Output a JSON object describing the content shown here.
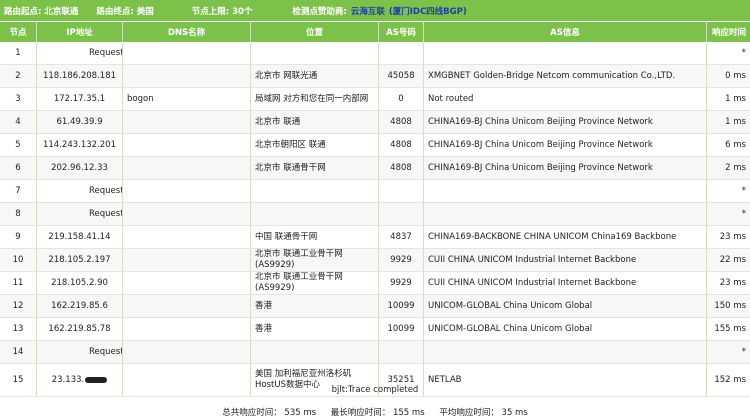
{
  "topbar": {
    "start": "路由起点: 北京联通",
    "end": "路由终点: 美国",
    "limit": "节点上限: 30个",
    "sponsor_label": "检测点赞助商:",
    "sponsor_name": "云海互联",
    "sponsor_detail": "(厦门IDC四线BGP)"
  },
  "columns": [
    "节点",
    "IP地址",
    "DNS名称",
    "位置",
    "AS号码",
    "AS信息",
    "响应时间"
  ],
  "rows": [
    {
      "hop": "1",
      "ip": "Request TimeOut",
      "dns": "",
      "loc": "",
      "as": "",
      "asinfo": "",
      "time": "*",
      "timeout": true
    },
    {
      "hop": "2",
      "ip": "118.186.208.181",
      "dns": "",
      "loc": "北京市 网联光通",
      "as": "45058",
      "asinfo": "XMGBNET Golden-Bridge Netcom communication Co.,LTD.",
      "time": "0 ms"
    },
    {
      "hop": "3",
      "ip": "172.17.35.1",
      "dns": "bogon",
      "loc": "局域网 对方和您在同一内部网",
      "as": "0",
      "asinfo": "Not routed",
      "time": "1 ms"
    },
    {
      "hop": "4",
      "ip": "61.49.39.9",
      "dns": "",
      "loc": "北京市 联通",
      "as": "4808",
      "asinfo": "CHINA169-BJ China Unicom Beijing Province Network",
      "time": "1 ms"
    },
    {
      "hop": "5",
      "ip": "114.243.132.201",
      "dns": "",
      "loc": "北京市朝阳区 联通",
      "as": "4808",
      "asinfo": "CHINA169-BJ China Unicom Beijing Province Network",
      "time": "6 ms"
    },
    {
      "hop": "6",
      "ip": "202.96.12.33",
      "dns": "",
      "loc": "北京市 联通骨干网",
      "as": "4808",
      "asinfo": "CHINA169-BJ China Unicom Beijing Province Network",
      "time": "2 ms"
    },
    {
      "hop": "7",
      "ip": "Request TimeOut",
      "dns": "",
      "loc": "",
      "as": "",
      "asinfo": "",
      "time": "*",
      "timeout": true
    },
    {
      "hop": "8",
      "ip": "Request TimeOut",
      "dns": "",
      "loc": "",
      "as": "",
      "asinfo": "",
      "time": "*",
      "timeout": true
    },
    {
      "hop": "9",
      "ip": "219.158.41.14",
      "dns": "",
      "loc": "中国 联通骨干网",
      "as": "4837",
      "asinfo": "CHINA169-BACKBONE CHINA UNICOM China169 Backbone",
      "time": "23 ms"
    },
    {
      "hop": "10",
      "ip": "218.105.2.197",
      "dns": "",
      "loc": "北京市 联通工业骨干网(AS9929)",
      "as": "9929",
      "asinfo": "CUII CHINA UNICOM Industrial Internet Backbone",
      "time": "22 ms"
    },
    {
      "hop": "11",
      "ip": "218.105.2.90",
      "dns": "",
      "loc": "北京市 联通工业骨干网(AS9929)",
      "as": "9929",
      "asinfo": "CUII CHINA UNICOM Industrial Internet Backbone",
      "time": "23 ms"
    },
    {
      "hop": "12",
      "ip": "162.219.85.6",
      "dns": "",
      "loc": "香港",
      "as": "10099",
      "asinfo": "UNICOM-GLOBAL China Unicom Global",
      "time": "150 ms"
    },
    {
      "hop": "13",
      "ip": "162.219.85.78",
      "dns": "",
      "loc": "香港",
      "as": "10099",
      "asinfo": "UNICOM-GLOBAL China Unicom Global",
      "time": "155 ms"
    },
    {
      "hop": "14",
      "ip": "Request TimeOut",
      "dns": "",
      "loc": "",
      "as": "",
      "asinfo": "",
      "time": "*",
      "timeout": true
    },
    {
      "hop": "15",
      "ip": "23.133.",
      "dns": "",
      "loc": "美国 加利福尼亚州洛杉矶HostUS数据中心",
      "as": "35251",
      "asinfo": "NETLAB",
      "time": "152 ms",
      "redacted": true,
      "tall": true
    }
  ],
  "footer": {
    "status": "bjlt:Trace completed",
    "total": "总共响应时间： 535 ms",
    "max": "最长响应时间： 155 ms",
    "avg": "平均响应时间： 35 ms"
  }
}
